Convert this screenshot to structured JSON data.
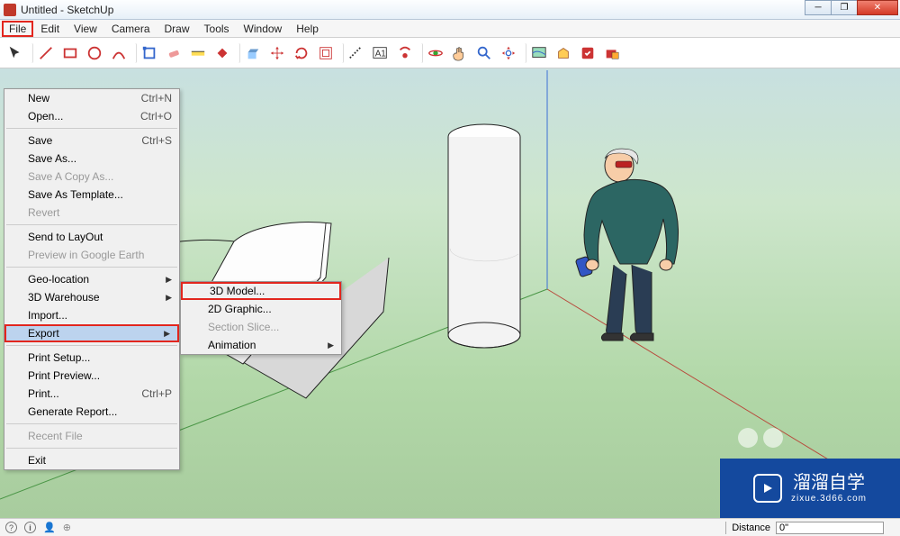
{
  "window": {
    "title": "Untitled - SketchUp"
  },
  "menubar": {
    "items": [
      "File",
      "Edit",
      "View",
      "Camera",
      "Draw",
      "Tools",
      "Window",
      "Help"
    ],
    "active": "File"
  },
  "file_menu": {
    "groups": [
      [
        {
          "label": "New",
          "shortcut": "Ctrl+N"
        },
        {
          "label": "Open...",
          "shortcut": "Ctrl+O"
        }
      ],
      [
        {
          "label": "Save",
          "shortcut": "Ctrl+S"
        },
        {
          "label": "Save As..."
        },
        {
          "label": "Save A Copy As...",
          "disabled": true
        },
        {
          "label": "Save As Template..."
        },
        {
          "label": "Revert",
          "disabled": true
        }
      ],
      [
        {
          "label": "Send to LayOut"
        },
        {
          "label": "Preview in Google Earth",
          "disabled": true
        }
      ],
      [
        {
          "label": "Geo-location",
          "submenu": true
        },
        {
          "label": "3D Warehouse",
          "submenu": true
        },
        {
          "label": "Import..."
        },
        {
          "label": "Export",
          "submenu": true,
          "highlighted": true
        }
      ],
      [
        {
          "label": "Print Setup..."
        },
        {
          "label": "Print Preview..."
        },
        {
          "label": "Print...",
          "shortcut": "Ctrl+P"
        },
        {
          "label": "Generate Report..."
        }
      ],
      [
        {
          "label": "Recent File",
          "disabled": true
        }
      ],
      [
        {
          "label": "Exit"
        }
      ]
    ]
  },
  "export_submenu": {
    "items": [
      {
        "label": "3D Model...",
        "highlighted": true
      },
      {
        "label": "2D Graphic..."
      },
      {
        "label": "Section Slice...",
        "disabled": true
      },
      {
        "label": "Animation",
        "submenu": true
      }
    ]
  },
  "toolbar_icons": [
    "select",
    "eraser",
    "line",
    "rect",
    "circle",
    "arc",
    "pencil",
    "rotate3d",
    "extrude",
    "move",
    "rotate",
    "scale",
    "offset",
    "bucket",
    "tape",
    "text",
    "dimension",
    "paint",
    "orbit",
    "pan",
    "zoom",
    "zoom-extents",
    "section",
    "layers",
    "outliner",
    "styles"
  ],
  "statusbar": {
    "distance_label": "Distance",
    "distance_value": "0\""
  },
  "watermark": {
    "main": "溜溜自学",
    "sub": "zixue.3d66.com"
  }
}
